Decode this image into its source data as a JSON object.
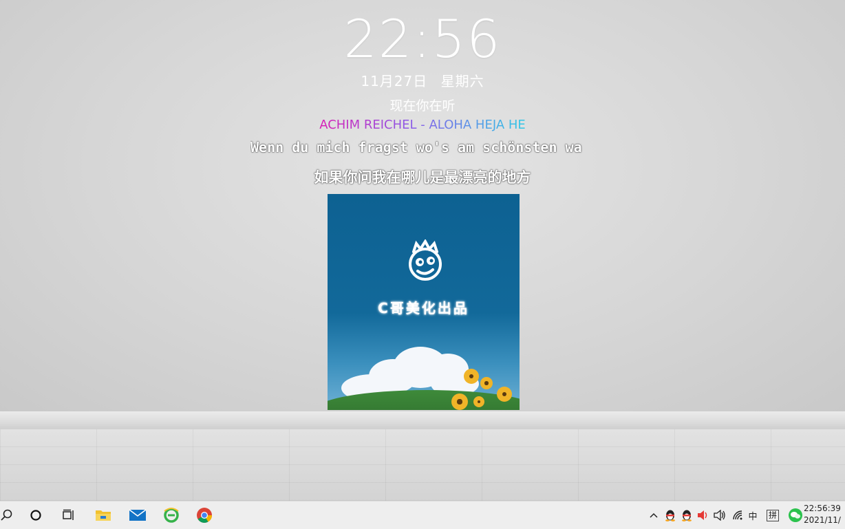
{
  "lockscreen": {
    "time": "22:56",
    "date": "11月27日",
    "weekday": "星期六",
    "now_playing_label": "现在你在听",
    "song": "ACHIM REICHEL - ALOHA HEJA HE",
    "lyric": "Wenn du mich fragst wo's am schönsten wa",
    "lyric_translation": "如果你问我在哪儿是最漂亮的地方",
    "album_brand": "C哥美化出品"
  },
  "taskbar": {
    "apps": [
      "search-icon",
      "cortana-icon",
      "task-view-icon",
      "file-explorer-icon",
      "mail-icon",
      "ie-icon",
      "chrome-icon"
    ],
    "tray": {
      "ime_lang": "中",
      "ime_mode": "拼",
      "clock_time": "22:56:39",
      "clock_date": "2021/11/"
    }
  },
  "colors": {
    "song_gradient_start": "#d81fb5",
    "song_gradient_end": "#2ec9e6",
    "album_bg": "#0d6192"
  }
}
